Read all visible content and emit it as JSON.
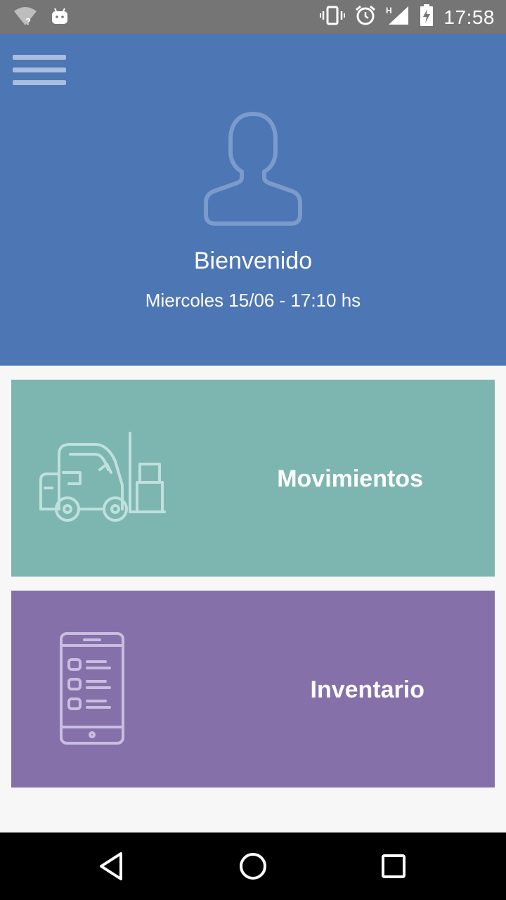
{
  "status_bar": {
    "time": "17:58",
    "icons": [
      "wifi-unknown-icon",
      "android-icon",
      "vibrate-icon",
      "alarm-icon",
      "signal-h-icon",
      "battery-charging-icon"
    ]
  },
  "header": {
    "menu_icon": "hamburger-menu-icon",
    "avatar_icon": "user-avatar-icon",
    "welcome": "Bienvenido",
    "date": "Miercoles 15/06 - 17:10 hs",
    "color": "#4d76b5"
  },
  "cards": {
    "movimientos": {
      "label": "Movimientos",
      "icon": "forklift-icon",
      "color": "#7db6b1"
    },
    "inventario": {
      "label": "Inventario",
      "icon": "phone-checklist-icon",
      "color": "#8570a9"
    }
  },
  "nav_bar": {
    "icons": [
      "back-icon",
      "home-icon",
      "recents-icon"
    ]
  }
}
